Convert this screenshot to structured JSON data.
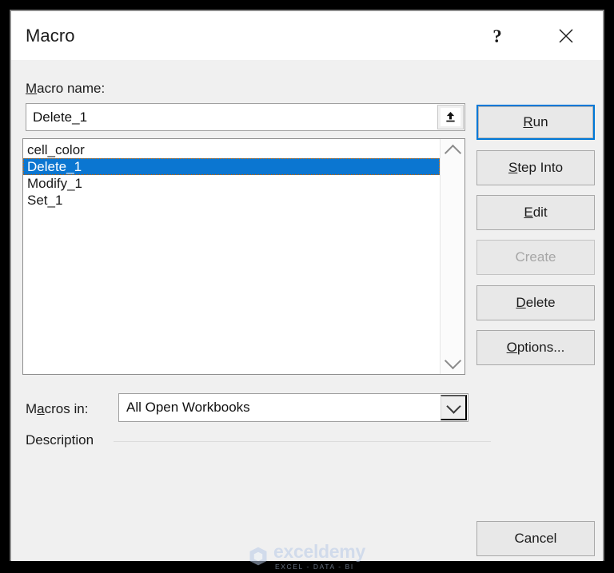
{
  "window": {
    "title": "Macro",
    "help_icon": "question-mark-icon",
    "close_icon": "close-icon"
  },
  "macro_name": {
    "label": "Macro name:",
    "label_accelerator": "M",
    "value": "Delete_1",
    "placeholder": "",
    "upload_icon": "upload-icon"
  },
  "macro_list": {
    "items": [
      {
        "name": "cell_color",
        "selected": false
      },
      {
        "name": "Delete_1",
        "selected": true
      },
      {
        "name": "Modify_1",
        "selected": false
      },
      {
        "name": "Set_1",
        "selected": false
      }
    ],
    "selected_index": 1,
    "selection_color": "#0b76d1",
    "focus_outline_color": "#c86400",
    "scrollbar": {
      "up_icon": "chevron-up-icon",
      "down_icon": "chevron-down-icon"
    }
  },
  "macros_in": {
    "label": "Macros in:",
    "label_accelerator": "a",
    "value": "All Open Workbooks",
    "options": [
      "All Open Workbooks"
    ],
    "arrow_icon": "chevron-down-icon"
  },
  "description": {
    "label": "Description",
    "text": ""
  },
  "buttons": {
    "run": {
      "label": "Run",
      "accelerator": "R",
      "enabled": true,
      "default": true
    },
    "step_into": {
      "label": "Step Into",
      "accelerator": "S",
      "enabled": true
    },
    "edit": {
      "label": "Edit",
      "accelerator": "E",
      "enabled": true
    },
    "create": {
      "label": "Create",
      "accelerator": "",
      "enabled": false
    },
    "delete": {
      "label": "Delete",
      "accelerator": "D",
      "enabled": true
    },
    "options": {
      "label": "Options...",
      "accelerator": "O",
      "enabled": true
    },
    "cancel": {
      "label": "Cancel",
      "accelerator": "",
      "enabled": true
    }
  },
  "watermark": {
    "name": "exceldemy",
    "tagline": "EXCEL - DATA - BI",
    "color": "#b9cbe8"
  },
  "colors": {
    "accent": "#0078d7",
    "dialog_background": "#f0f0f0",
    "titlebar_background": "#ffffff"
  }
}
